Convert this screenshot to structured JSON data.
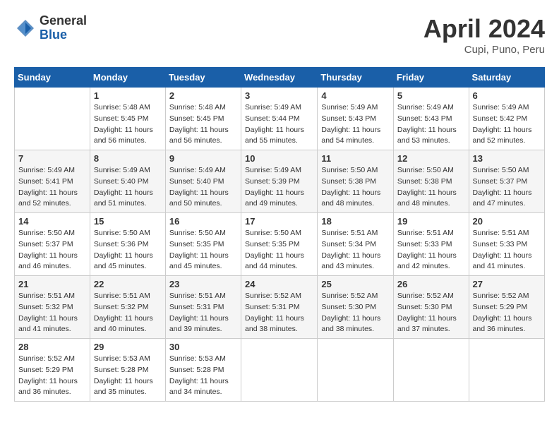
{
  "header": {
    "logo_general": "General",
    "logo_blue": "Blue",
    "month_title": "April 2024",
    "subtitle": "Cupi, Puno, Peru"
  },
  "columns": [
    "Sunday",
    "Monday",
    "Tuesday",
    "Wednesday",
    "Thursday",
    "Friday",
    "Saturday"
  ],
  "weeks": [
    [
      {
        "day": "",
        "info": ""
      },
      {
        "day": "1",
        "info": "Sunrise: 5:48 AM\nSunset: 5:45 PM\nDaylight: 11 hours\nand 56 minutes."
      },
      {
        "day": "2",
        "info": "Sunrise: 5:48 AM\nSunset: 5:45 PM\nDaylight: 11 hours\nand 56 minutes."
      },
      {
        "day": "3",
        "info": "Sunrise: 5:49 AM\nSunset: 5:44 PM\nDaylight: 11 hours\nand 55 minutes."
      },
      {
        "day": "4",
        "info": "Sunrise: 5:49 AM\nSunset: 5:43 PM\nDaylight: 11 hours\nand 54 minutes."
      },
      {
        "day": "5",
        "info": "Sunrise: 5:49 AM\nSunset: 5:43 PM\nDaylight: 11 hours\nand 53 minutes."
      },
      {
        "day": "6",
        "info": "Sunrise: 5:49 AM\nSunset: 5:42 PM\nDaylight: 11 hours\nand 52 minutes."
      }
    ],
    [
      {
        "day": "7",
        "info": "Sunrise: 5:49 AM\nSunset: 5:41 PM\nDaylight: 11 hours\nand 52 minutes."
      },
      {
        "day": "8",
        "info": "Sunrise: 5:49 AM\nSunset: 5:40 PM\nDaylight: 11 hours\nand 51 minutes."
      },
      {
        "day": "9",
        "info": "Sunrise: 5:49 AM\nSunset: 5:40 PM\nDaylight: 11 hours\nand 50 minutes."
      },
      {
        "day": "10",
        "info": "Sunrise: 5:49 AM\nSunset: 5:39 PM\nDaylight: 11 hours\nand 49 minutes."
      },
      {
        "day": "11",
        "info": "Sunrise: 5:50 AM\nSunset: 5:38 PM\nDaylight: 11 hours\nand 48 minutes."
      },
      {
        "day": "12",
        "info": "Sunrise: 5:50 AM\nSunset: 5:38 PM\nDaylight: 11 hours\nand 48 minutes."
      },
      {
        "day": "13",
        "info": "Sunrise: 5:50 AM\nSunset: 5:37 PM\nDaylight: 11 hours\nand 47 minutes."
      }
    ],
    [
      {
        "day": "14",
        "info": "Sunrise: 5:50 AM\nSunset: 5:37 PM\nDaylight: 11 hours\nand 46 minutes."
      },
      {
        "day": "15",
        "info": "Sunrise: 5:50 AM\nSunset: 5:36 PM\nDaylight: 11 hours\nand 45 minutes."
      },
      {
        "day": "16",
        "info": "Sunrise: 5:50 AM\nSunset: 5:35 PM\nDaylight: 11 hours\nand 45 minutes."
      },
      {
        "day": "17",
        "info": "Sunrise: 5:50 AM\nSunset: 5:35 PM\nDaylight: 11 hours\nand 44 minutes."
      },
      {
        "day": "18",
        "info": "Sunrise: 5:51 AM\nSunset: 5:34 PM\nDaylight: 11 hours\nand 43 minutes."
      },
      {
        "day": "19",
        "info": "Sunrise: 5:51 AM\nSunset: 5:33 PM\nDaylight: 11 hours\nand 42 minutes."
      },
      {
        "day": "20",
        "info": "Sunrise: 5:51 AM\nSunset: 5:33 PM\nDaylight: 11 hours\nand 41 minutes."
      }
    ],
    [
      {
        "day": "21",
        "info": "Sunrise: 5:51 AM\nSunset: 5:32 PM\nDaylight: 11 hours\nand 41 minutes."
      },
      {
        "day": "22",
        "info": "Sunrise: 5:51 AM\nSunset: 5:32 PM\nDaylight: 11 hours\nand 40 minutes."
      },
      {
        "day": "23",
        "info": "Sunrise: 5:51 AM\nSunset: 5:31 PM\nDaylight: 11 hours\nand 39 minutes."
      },
      {
        "day": "24",
        "info": "Sunrise: 5:52 AM\nSunset: 5:31 PM\nDaylight: 11 hours\nand 38 minutes."
      },
      {
        "day": "25",
        "info": "Sunrise: 5:52 AM\nSunset: 5:30 PM\nDaylight: 11 hours\nand 38 minutes."
      },
      {
        "day": "26",
        "info": "Sunrise: 5:52 AM\nSunset: 5:30 PM\nDaylight: 11 hours\nand 37 minutes."
      },
      {
        "day": "27",
        "info": "Sunrise: 5:52 AM\nSunset: 5:29 PM\nDaylight: 11 hours\nand 36 minutes."
      }
    ],
    [
      {
        "day": "28",
        "info": "Sunrise: 5:52 AM\nSunset: 5:29 PM\nDaylight: 11 hours\nand 36 minutes."
      },
      {
        "day": "29",
        "info": "Sunrise: 5:53 AM\nSunset: 5:28 PM\nDaylight: 11 hours\nand 35 minutes."
      },
      {
        "day": "30",
        "info": "Sunrise: 5:53 AM\nSunset: 5:28 PM\nDaylight: 11 hours\nand 34 minutes."
      },
      {
        "day": "",
        "info": ""
      },
      {
        "day": "",
        "info": ""
      },
      {
        "day": "",
        "info": ""
      },
      {
        "day": "",
        "info": ""
      }
    ]
  ]
}
